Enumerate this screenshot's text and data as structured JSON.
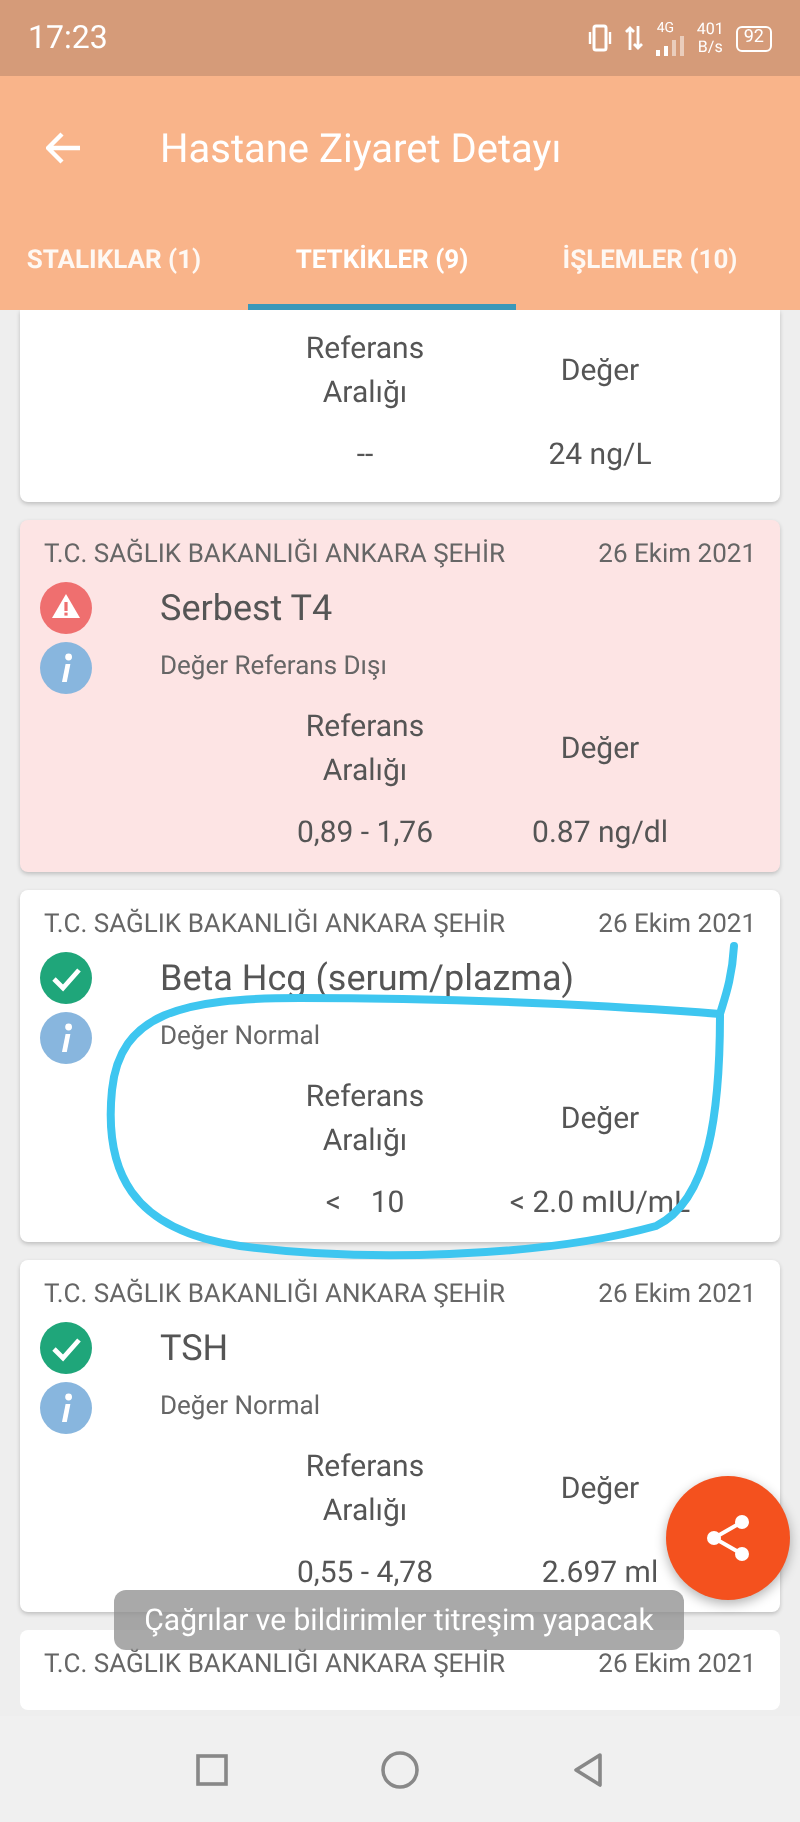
{
  "status_bar": {
    "time": "17:23",
    "network_type": "4G",
    "speed": "401",
    "speed_unit": "B/s",
    "battery": "92"
  },
  "app_bar": {
    "title": "Hastane Ziyaret Detayı"
  },
  "tabs": [
    {
      "label": "STALIKLAR (1)",
      "selected": false
    },
    {
      "label": "TETKİKLER (9)",
      "selected": true
    },
    {
      "label": "İŞLEMLER (10)",
      "selected": false
    }
  ],
  "partial_card": {
    "range_label": "Referans Aralığı",
    "value_label": "Değer",
    "range": "--",
    "value": "24 ng/L"
  },
  "tests": [
    {
      "kind": "abnormal",
      "hospital": "T.C. SAĞLIK BAKANLIĞI ANKARA ŞEHİR",
      "date": "26 Ekim 2021",
      "name": "Serbest T4",
      "status": "Değer Referans Dışı",
      "range_label": "Referans Aralığı",
      "value_label": "Değer",
      "range": "0,89 - 1,76",
      "value": "0.87 ng/dl"
    },
    {
      "kind": "normal",
      "hospital": "T.C. SAĞLIK BAKANLIĞI ANKARA ŞEHİR",
      "date": "26 Ekim 2021",
      "name": "Beta Hcg (serum/plazma)",
      "status": "Değer Normal",
      "range_label": "Referans Aralığı",
      "value_label": "Değer",
      "range": "<    10",
      "value": "< 2.0 mIU/mL"
    },
    {
      "kind": "normal",
      "hospital": "T.C. SAĞLIK BAKANLIĞI ANKARA ŞEHİR",
      "date": "26 Ekim 2021",
      "name": "TSH",
      "status": "Değer Normal",
      "range_label": "Referans Aralığı",
      "value_label": "Değer",
      "range": "0,55 - 4,78",
      "value": "2.697 ml"
    }
  ],
  "next_card": {
    "hospital": "T.C. SAĞLIK BAKANLIĞI ANKARA ŞEHİR",
    "date": "26 Ekim 2021"
  },
  "toast": {
    "text": "Çağrılar ve bildirimler titreşim yapacak"
  }
}
